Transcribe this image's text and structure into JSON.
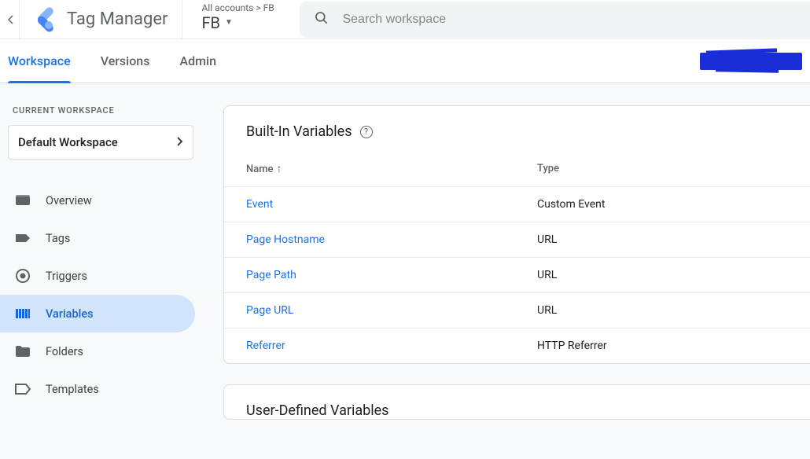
{
  "header": {
    "product": "Tag Manager",
    "breadcrumb": "All accounts > FB",
    "container": "FB",
    "search_placeholder": "Search workspace"
  },
  "nav": {
    "tabs": [
      "Workspace",
      "Versions",
      "Admin"
    ],
    "active_index": 0
  },
  "sidebar": {
    "section_label": "CURRENT WORKSPACE",
    "workspace_name": "Default Workspace",
    "items": [
      {
        "label": "Overview",
        "icon": "dashboard"
      },
      {
        "label": "Tags",
        "icon": "tag"
      },
      {
        "label": "Triggers",
        "icon": "target"
      },
      {
        "label": "Variables",
        "icon": "variable"
      },
      {
        "label": "Folders",
        "icon": "folder"
      },
      {
        "label": "Templates",
        "icon": "template"
      }
    ],
    "active_index": 3
  },
  "builtin": {
    "title": "Built-In Variables",
    "columns": {
      "name": "Name",
      "type": "Type"
    },
    "rows": [
      {
        "name": "Event",
        "type": "Custom Event"
      },
      {
        "name": "Page Hostname",
        "type": "URL"
      },
      {
        "name": "Page Path",
        "type": "URL"
      },
      {
        "name": "Page URL",
        "type": "URL"
      },
      {
        "name": "Referrer",
        "type": "HTTP Referrer"
      }
    ]
  },
  "userdef": {
    "title": "User-Defined Variables"
  }
}
